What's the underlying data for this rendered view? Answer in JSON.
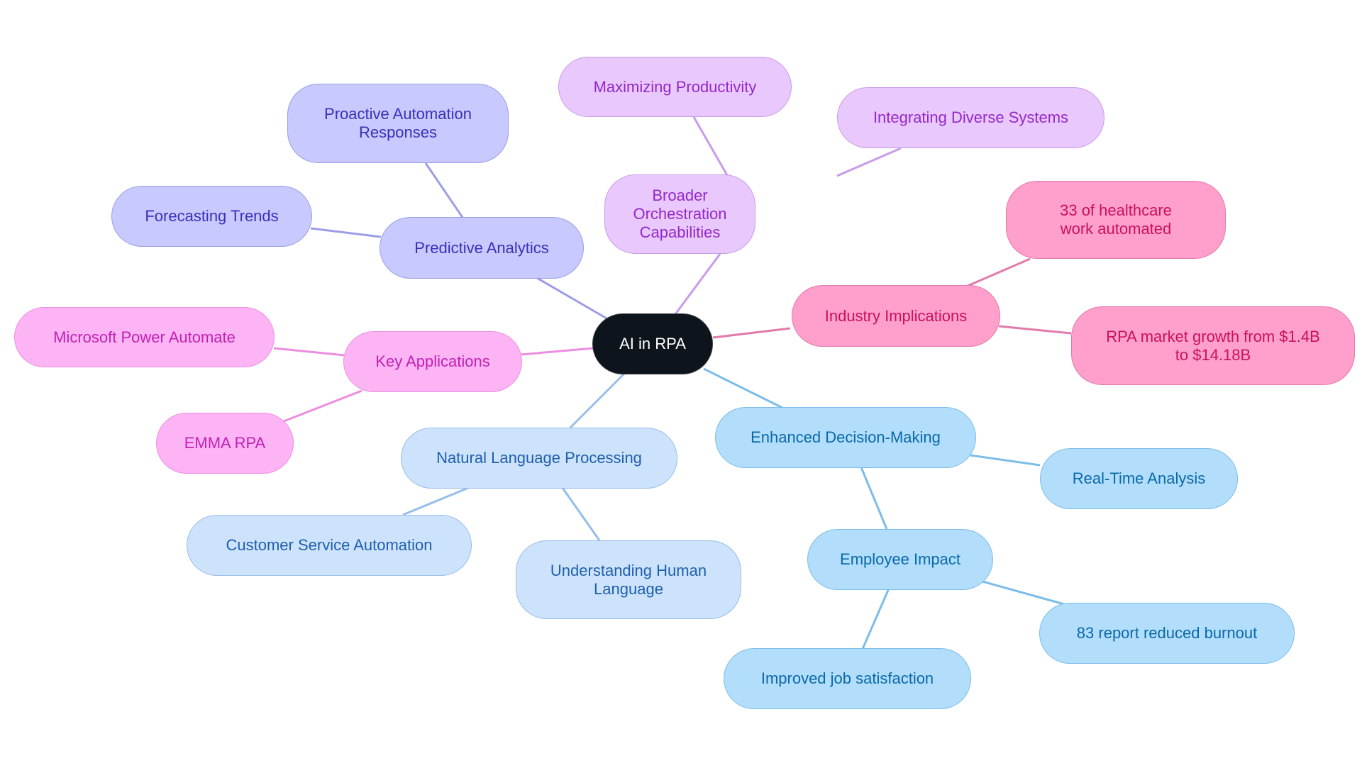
{
  "diagram": {
    "type": "mindmap",
    "root": {
      "id": "root",
      "label": "AI in RPA"
    },
    "colors": {
      "root_fill": "#0d141b",
      "predictive_analytics": "#c7c9ff",
      "broader_orchestration": "#e9c8fd",
      "industry_implications": "#ff9fcb",
      "key_applications": "#fdb4f4",
      "natural_language_processing": "#cde3fb",
      "enhanced_decision_making": "#b2ddfb"
    },
    "nodes": {
      "predictive_analytics": {
        "label": "Predictive Analytics",
        "parent": "root"
      },
      "proactive_automation": {
        "label": "Proactive Automation Responses",
        "parent": "predictive_analytics"
      },
      "forecasting_trends": {
        "label": "Forecasting Trends",
        "parent": "predictive_analytics"
      },
      "broader_orchestration": {
        "label": "Broader Orchestration Capabilities",
        "parent": "root"
      },
      "maximizing_productivity": {
        "label": "Maximizing Productivity",
        "parent": "broader_orchestration"
      },
      "integrating_systems": {
        "label": "Integrating Diverse Systems",
        "parent": "broader_orchestration"
      },
      "industry_implications": {
        "label": "Industry Implications",
        "parent": "root"
      },
      "healthcare_automated": {
        "label": "33 of healthcare work automated",
        "parent": "industry_implications"
      },
      "rpa_market_growth": {
        "label": "RPA market growth from $1.4B to $14.18B",
        "parent": "industry_implications"
      },
      "key_applications": {
        "label": "Key Applications",
        "parent": "root"
      },
      "power_automate": {
        "label": "Microsoft Power Automate",
        "parent": "key_applications"
      },
      "emma_rpa": {
        "label": "EMMA RPA",
        "parent": "key_applications"
      },
      "nlp": {
        "label": "Natural Language Processing",
        "parent": "root"
      },
      "customer_service": {
        "label": "Customer Service Automation",
        "parent": "nlp"
      },
      "understanding_language": {
        "label": "Understanding Human Language",
        "parent": "nlp"
      },
      "enhanced_decision": {
        "label": "Enhanced Decision-Making",
        "parent": "root"
      },
      "real_time_analysis": {
        "label": "Real-Time Analysis",
        "parent": "enhanced_decision"
      },
      "employee_impact": {
        "label": "Employee Impact",
        "parent": "enhanced_decision"
      },
      "reduced_burnout": {
        "label": "83 report reduced burnout",
        "parent": "employee_impact"
      },
      "job_satisfaction": {
        "label": "Improved job satisfaction",
        "parent": "employee_impact"
      }
    }
  }
}
